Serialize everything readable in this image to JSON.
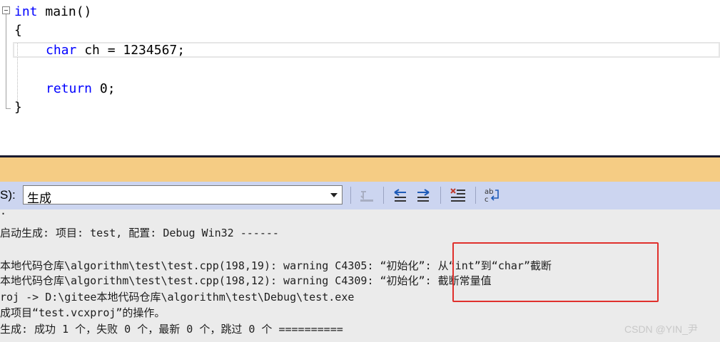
{
  "editor": {
    "lines": [
      {
        "kw": "int",
        "text": " main()"
      },
      {
        "kw": "",
        "text": "{"
      },
      {
        "kw": "char",
        "text": " ch = 1234567;"
      },
      {
        "kw": "return",
        "text": " 0;"
      },
      {
        "kw": "",
        "text": "}"
      }
    ]
  },
  "output_panel": {
    "source_label": "S):",
    "source_value": "生成",
    "lines": [
      "·",
      "启动生成: 项目: test, 配置: Debug Win32 ------",
      "本地代码仓库\\algorithm\\test\\test.cpp(198,19): warning C4305: “初始化”: 从“int”到“char”截断",
      "本地代码仓库\\algorithm\\test\\test.cpp(198,12): warning C4309: “初始化”: 截断常量值",
      "roj -> D:\\gitee本地代码仓库\\algorithm\\test\\Debug\\test.exe",
      "成项目“test.vcxproj”的操作。",
      "生成: 成功 1 个，失败 0 个，最新 0 个，跳过 0 个 =========="
    ]
  },
  "watermark": "CSDN @YIN_尹",
  "colors": {
    "keyword": "#0000ff",
    "panel_title": "#f5cc84",
    "toolbar": "#ccd5f0",
    "highlight": "#e0302c"
  }
}
